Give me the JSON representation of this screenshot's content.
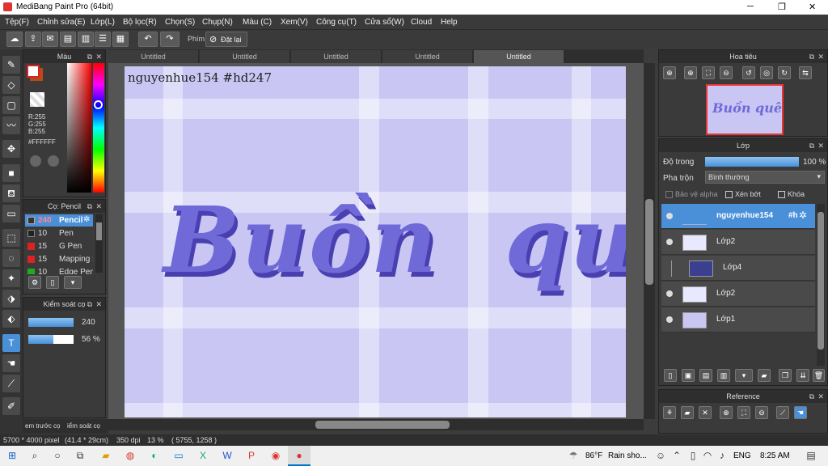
{
  "window": {
    "title": "MediBang Paint Pro (64bit)",
    "minimize": "─",
    "maximize": "❐",
    "close": "✕"
  },
  "menu": [
    "Tệp(F)",
    "Chỉnh sửa(E)",
    "Lớp(L)",
    "Bộ lọc(R)",
    "Chọn(S)",
    "Chụp(N)",
    "Màu (C)",
    "Xem(V)",
    "Công cụ(T)",
    "Cửa sổ(W)",
    "Cloud",
    "Help"
  ],
  "toolbar": {
    "shortcut_label": "Phím",
    "reset_label": "Đặt lại"
  },
  "color_panel": {
    "title": "Màu",
    "rgb_r": "R:255",
    "rgb_g": "G:255",
    "rgb_b": "B:255",
    "hex": "#FFFFFF"
  },
  "brush_panel": {
    "title": "Cọ: Pencil",
    "items": [
      {
        "size": "240",
        "name": "Pencil",
        "color": "#333"
      },
      {
        "size": "10",
        "name": "Pen",
        "color": "#222"
      },
      {
        "size": "15",
        "name": "G Pen",
        "color": "#d22"
      },
      {
        "size": "15",
        "name": "Mapping Pen",
        "color": "#d22"
      },
      {
        "size": "10",
        "name": "Edge Pen",
        "color": "#2a2"
      }
    ]
  },
  "brush_control": {
    "title": "Kiểm soát cọ",
    "size_value": "240",
    "opacity_value": "56 %",
    "opacity": 0.56
  },
  "bottom_tabs": [
    "em trước cọ",
    "iểm soát cọ"
  ],
  "doc_tabs": [
    "Untitled",
    "Untitled",
    "Untitled",
    "Untitled",
    "Untitled"
  ],
  "canvas": {
    "watermark": "nguyenhue154 #hd247",
    "lettering": "Buồn  quê"
  },
  "navigator": {
    "title": "Hoa tiêu",
    "thumb_text": "Buồn quê"
  },
  "layer_panel": {
    "title": "Lớp",
    "opacity_label": "Độ trong",
    "opacity_value": "100 %",
    "opacity": 1.0,
    "blend_label": "Pha trộn",
    "blend_value": "Bình thường",
    "protect_alpha": "Bảo vệ alpha",
    "clipping": "Xén bớt",
    "lock": "Khóa"
  },
  "layers": [
    {
      "name": "nguyenhue154",
      "suffix": "#h",
      "selected": true
    },
    {
      "name": "Lớp2",
      "selected": false
    },
    {
      "name": "Lớp4",
      "selected": false
    },
    {
      "name": "Lớp2",
      "selected": false
    },
    {
      "name": "Lớp1",
      "selected": false
    }
  ],
  "reference_panel": {
    "title": "Reference"
  },
  "status": {
    "size": "5700 * 4000 pixel",
    "cm": "(41.4 * 29cm)",
    "dpi": "350 dpi",
    "zoom": "13 %",
    "coords": "( 5755, 1258 )"
  },
  "taskbar": {
    "weather_temp": "86°F",
    "weather_text": "Rain sho...",
    "lang": "ENG",
    "time": "8:25 AM"
  },
  "colors": {
    "canvas_bg": "#c9c6f4",
    "lettering": "#6f6ad8",
    "selected_layer": "#4a90d9",
    "accent": "#5aa0e0"
  }
}
